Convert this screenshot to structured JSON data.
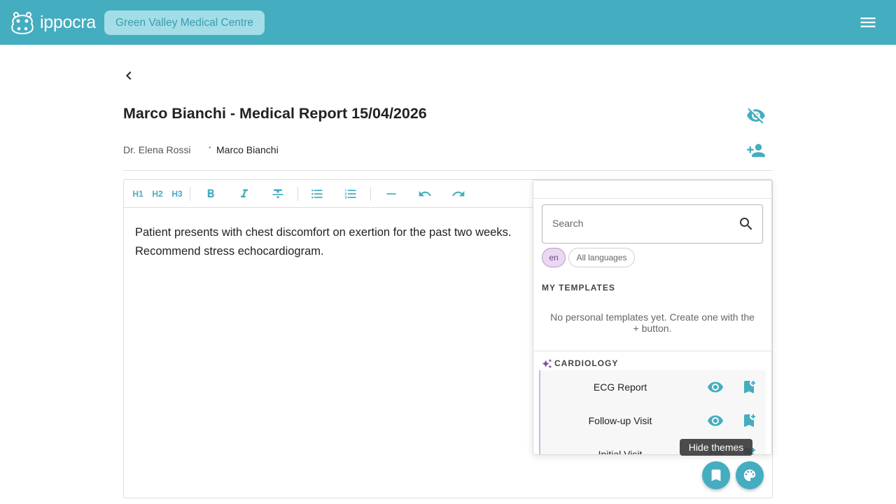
{
  "header": {
    "brand": "ippocra",
    "clinic": "Green Valley Medical Centre"
  },
  "report": {
    "title": "Marco Bianchi - Medical Report 15/04/2026",
    "doctor": "Dr. Elena Rossi",
    "separator": "•",
    "patient": "Marco Bianchi"
  },
  "toolbar": {
    "h1": "H1",
    "h2": "H2",
    "h3": "H3"
  },
  "editor": {
    "line1": "Patient presents with chest discomfort on exertion for the past two weeks.",
    "line2": "Recommend stress echocardiogram."
  },
  "templates": {
    "search_placeholder": "Search",
    "lang_selected": "en",
    "lang_all": "All languages",
    "my_templates_label": "MY TEMPLATES",
    "empty_note": "No personal templates yet. Create one with the + button.",
    "category": "CARDIOLOGY",
    "items": [
      {
        "name": "ECG Report"
      },
      {
        "name": "Follow-up Visit"
      },
      {
        "name": "Initial Visit"
      }
    ]
  },
  "tooltip": "Hide themes",
  "icons": {
    "logo": "hippo-logo-icon",
    "menu": "menu-icon",
    "back": "chevron-left-icon",
    "visibility": "visibility-off-icon",
    "add_person": "person-add-icon",
    "search": "search-icon",
    "preview": "eye-icon",
    "bookmark": "bookmark-add-icon",
    "templates": "bookmark-icon",
    "themes": "palette-icon"
  },
  "colors": {
    "brand": "#44adc0",
    "chip_bg": "#a3dde6",
    "accent_purple": "#6b3f85"
  }
}
